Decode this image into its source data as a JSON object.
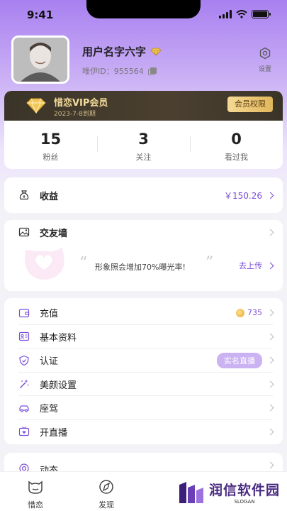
{
  "status_bar": {
    "time": "9:41"
  },
  "profile": {
    "username": "用户名字六字",
    "uid": "唯伊ID：955564",
    "settings_label": "设置"
  },
  "vip": {
    "title": "惜恋VIP会员",
    "expire": "2023-7-8到期",
    "button": "会员权限"
  },
  "stats": [
    {
      "value": "15",
      "label": "粉丝"
    },
    {
      "value": "3",
      "label": "关注"
    },
    {
      "value": "0",
      "label": "看过我"
    }
  ],
  "earnings": {
    "label": "收益",
    "value": "￥150.26"
  },
  "wall": {
    "title": "交友墙",
    "tip": "形象照会增加70%曝光率!",
    "upload": "去上传",
    "quote_open": "“",
    "quote_close": "”"
  },
  "menu": [
    {
      "label": "充值",
      "extra": "735"
    },
    {
      "label": "基本资料"
    },
    {
      "label": "认证",
      "badge": "实名直播"
    },
    {
      "label": "美颜设置"
    },
    {
      "label": "座驾"
    },
    {
      "label": "开直播"
    }
  ],
  "moments": {
    "label": "动态"
  },
  "tabs": [
    {
      "label": "惜恋"
    },
    {
      "label": "发现"
    }
  ],
  "watermark": {
    "title": "润信软件园",
    "slogan": "SLOGAN"
  },
  "colors": {
    "accent": "#7a4fd6",
    "vip_gold": "#f4dc9c",
    "badge": "#cbb2f3"
  }
}
